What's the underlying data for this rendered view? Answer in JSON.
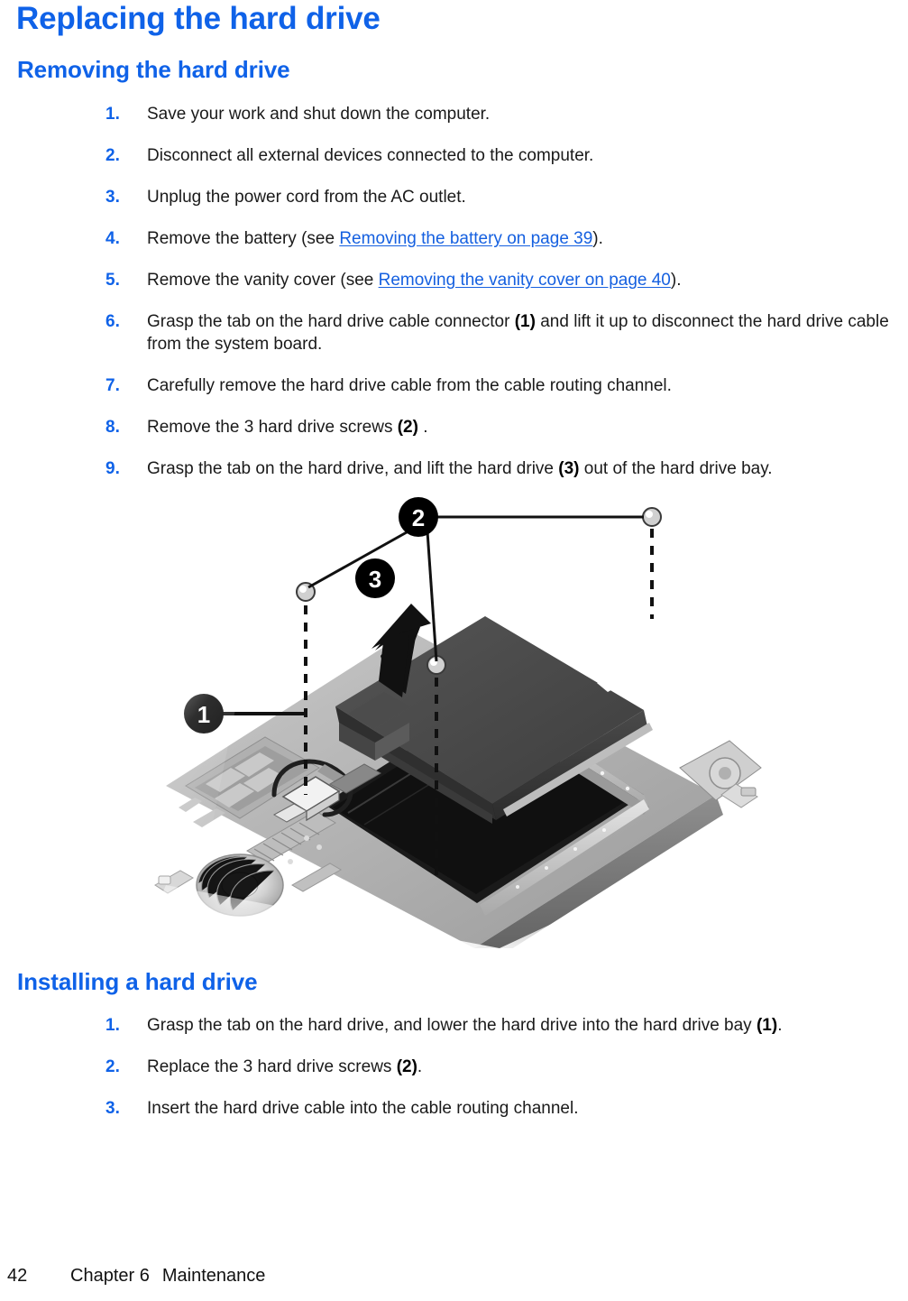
{
  "page": {
    "title": "Replacing the hard drive",
    "background_color": "#ffffff",
    "heading_color": "#0F62E8",
    "body_text_color": "#1a1a1a",
    "link_color": "#1560E0"
  },
  "sections": [
    {
      "heading": "Removing the hard drive",
      "steps": [
        {
          "number": "1.",
          "text": "Save your work and shut down the computer."
        },
        {
          "number": "2.",
          "text": "Disconnect all external devices connected to the computer."
        },
        {
          "number": "3.",
          "text": "Unplug the power cord from the AC outlet."
        },
        {
          "number": "4.",
          "prefix": "Remove the battery (see ",
          "link": "Removing the battery on page 39",
          "suffix": ")."
        },
        {
          "number": "5.",
          "prefix": "Remove the vanity cover (see ",
          "link": "Removing the vanity cover on page 40",
          "suffix": ")."
        },
        {
          "number": "6.",
          "parts": [
            {
              "t": "Grasp the tab on the hard drive cable connector "
            },
            {
              "t": "(1)",
              "bold": true
            },
            {
              "t": " and lift it up to disconnect the hard drive cable from the system board."
            }
          ]
        },
        {
          "number": "7.",
          "text": "Carefully remove the hard drive cable from the cable routing channel."
        },
        {
          "number": "8.",
          "parts": [
            {
              "t": "Remove the 3 hard drive screws "
            },
            {
              "t": "(2)",
              "bold": true
            },
            {
              "t": " ."
            }
          ]
        },
        {
          "number": "9.",
          "parts": [
            {
              "t": "Grasp the tab on the hard drive, and lift the hard drive "
            },
            {
              "t": "(3)",
              "bold": true
            },
            {
              "t": " out of the hard drive bay."
            }
          ]
        }
      ]
    },
    {
      "heading": "Installing a hard drive",
      "steps": [
        {
          "number": "1.",
          "parts": [
            {
              "t": "Grasp the tab on the hard drive, and lower the hard drive into the hard drive bay "
            },
            {
              "t": "(1)",
              "bold": true
            },
            {
              "t": "."
            }
          ]
        },
        {
          "number": "2.",
          "parts": [
            {
              "t": "Replace the 3 hard drive screws "
            },
            {
              "t": "(2)",
              "bold": true
            },
            {
              "t": "."
            }
          ]
        },
        {
          "number": "3.",
          "text": "Insert the hard drive cable into the cable routing channel."
        }
      ]
    }
  ],
  "figure": {
    "alt": "Exploded grayscale illustration of a notebook computer base enclosure showing the hard drive being lifted out of the hard drive bay",
    "callouts": [
      {
        "label": "1",
        "meaning": "hard drive cable connector"
      },
      {
        "label": "2",
        "meaning": "hard drive screws"
      },
      {
        "label": "3",
        "meaning": "hard drive lift direction"
      }
    ]
  },
  "footer": {
    "page_number": "42",
    "chapter": "Chapter 6",
    "chapter_title": "Maintenance"
  }
}
